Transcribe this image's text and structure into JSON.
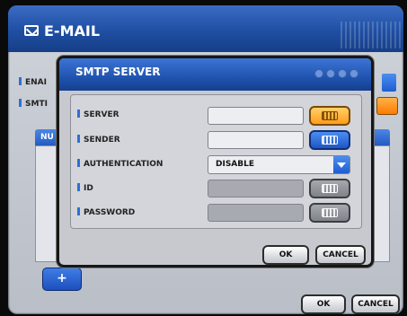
{
  "email_window": {
    "title": "E-MAIL",
    "bg_label_1": "ENAI",
    "bg_label_2": "SMTI",
    "table_header": "NU",
    "add_label": "+",
    "ok_label": "OK",
    "cancel_label": "CANCEL"
  },
  "smtp_dialog": {
    "title": "SMTP SERVER",
    "rows": {
      "server": "SERVER",
      "sender": "SENDER",
      "authentication": "AUTHENTICATION",
      "id": "ID",
      "password": "PASSWORD"
    },
    "authentication_value": "DISABLE",
    "ok_label": "OK",
    "cancel_label": "CANCEL"
  },
  "colors": {
    "header_blue": "#1f4fa3",
    "accent_orange": "#ff9d1a",
    "accent_blue": "#1e56c4"
  },
  "icons": [
    "envelope-icon",
    "keyboard-icon",
    "dropdown-arrow-icon"
  ]
}
